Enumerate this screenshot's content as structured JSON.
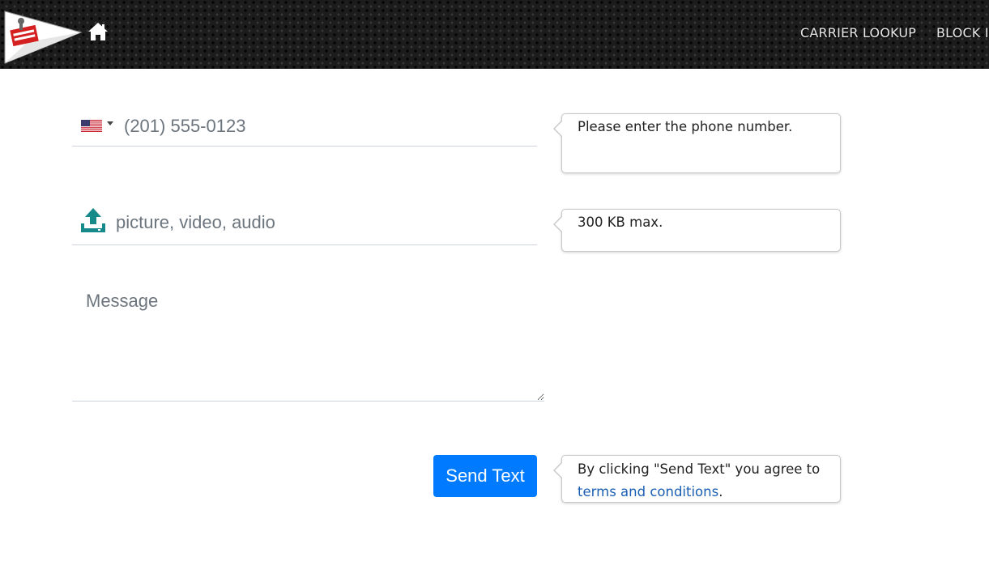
{
  "header": {
    "nav": {
      "carrier_lookup": "CARRIER LOOKUP",
      "block": "BLOCK I"
    },
    "icons": {
      "logo": "paper-airplane-logo",
      "home": "home-icon"
    }
  },
  "form": {
    "phone": {
      "country_icon": "us-flag-icon",
      "placeholder": "(201) 555-0123",
      "value": ""
    },
    "attachment": {
      "icon": "upload-icon",
      "placeholder": "picture, video, audio"
    },
    "message": {
      "placeholder": "Message"
    },
    "send_button": "Send Text"
  },
  "tooltips": {
    "phone": "Please enter the phone number.",
    "attachment": "300 KB max.",
    "terms_prefix": "By clicking \"Send Text\" you agree to",
    "terms_link": "terms and conditions",
    "terms_suffix": "."
  },
  "colors": {
    "header_bg": "#1c1c1c",
    "primary": "#007bff",
    "upload_icon": "#168a8a",
    "link": "#1a5fb4"
  }
}
